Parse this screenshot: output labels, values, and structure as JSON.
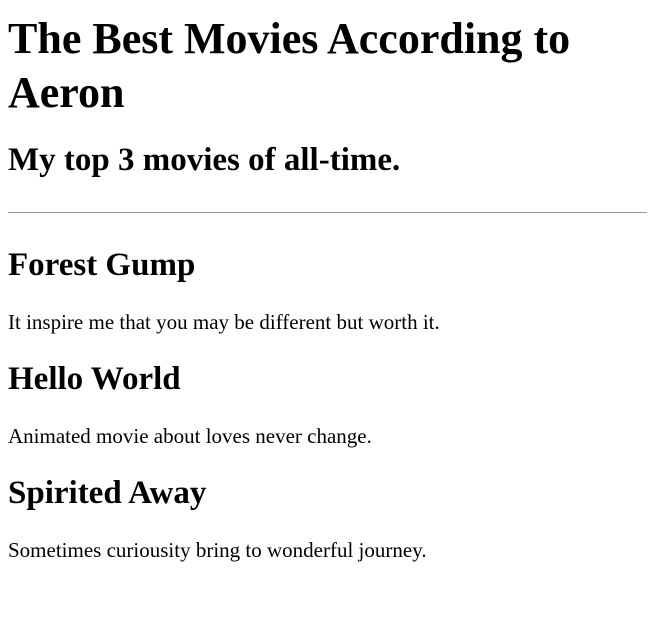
{
  "header": {
    "title": "The Best Movies According to Aeron",
    "subtitle": "My top 3 movies of all-time."
  },
  "movies": [
    {
      "title": "Forest Gump",
      "description": "It inspire me that you may be different but worth it."
    },
    {
      "title": "Hello World",
      "description": "Animated movie about loves never change."
    },
    {
      "title": "Spirited Away",
      "description": "Sometimes curiousity bring to wonderful journey."
    }
  ]
}
